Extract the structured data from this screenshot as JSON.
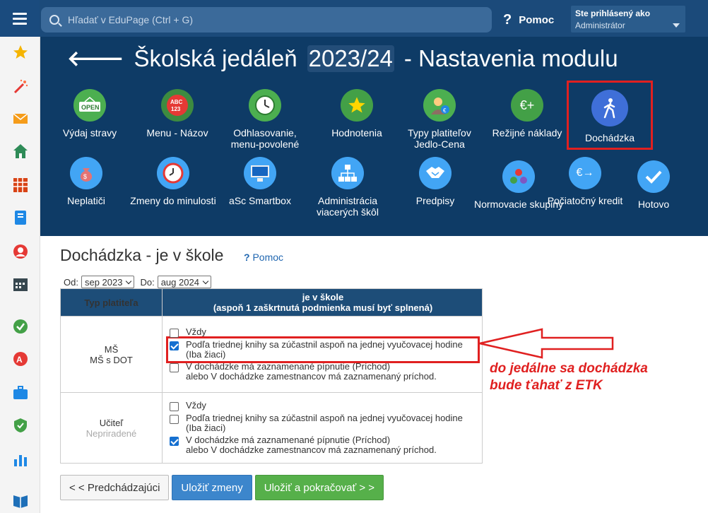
{
  "topbar": {
    "search_placeholder": "Hľadať v EduPage (Ctrl + G)",
    "help_label": "Pomoc",
    "login_title": "Ste prihlásený ako",
    "login_user": "Administrátor"
  },
  "header": {
    "title_prefix": "Školská jedáleň",
    "title_year": "2023/24",
    "title_suffix": "- Nastavenia modulu"
  },
  "tiles": [
    {
      "label": "Výdaj stravy",
      "icon": "open-sign-icon",
      "color": "#4caf50"
    },
    {
      "label": "Menu - Názov",
      "icon": "abc-icon",
      "color": "#3d8b40"
    },
    {
      "label": "Odhlasovanie, menu-povolené",
      "icon": "clock-icon",
      "color": "#4caf50"
    },
    {
      "label": "Hodnotenia",
      "icon": "star-icon",
      "color": "#43a047"
    },
    {
      "label": "Typy platiteľov Jedlo-Cena",
      "icon": "payer-icon",
      "color": "#4caf50"
    },
    {
      "label": "Režijné náklady",
      "icon": "euro-plus-icon",
      "color": "#43a047"
    },
    {
      "label": "Dochádzka",
      "icon": "walking-icon",
      "color": "#3f6fd8"
    },
    {
      "label": "Neplatiči",
      "icon": "moneybag-icon",
      "color": "#42a5f5"
    },
    {
      "label": "Zmeny do minulosti",
      "icon": "history-clock-icon",
      "color": "#42a5f5"
    },
    {
      "label": "aSc Smartbox",
      "icon": "monitor-icon",
      "color": "#42a5f5"
    },
    {
      "label": "Administrácia viacerých škôl",
      "icon": "hierarchy-icon",
      "color": "#42a5f5"
    },
    {
      "label": "Predpisy",
      "icon": "handshake-icon",
      "color": "#42a5f5"
    },
    {
      "label": "Normovacie skupiny",
      "icon": "dots-icon",
      "color": "#42a5f5"
    },
    {
      "label": "Počiatočný kredit",
      "icon": "euro-arrow-icon",
      "color": "#42a5f5"
    },
    {
      "label": "Hotovo",
      "icon": "check-icon",
      "color": "#42a5f5"
    }
  ],
  "page": {
    "heading": "Dochádzka - je v škole",
    "help_mark": "?",
    "help_label": "Pomoc",
    "from_label": "Od:",
    "from_value": "sep 2023",
    "to_label": "Do:",
    "to_value": "aug 2024"
  },
  "table": {
    "col1_header": "Typ platiteľa",
    "col2_header_line1": "je v škole",
    "col2_header_line2": "(aspoň 1 zaškrtnutá podmienka musí byť splnená)",
    "rows": [
      {
        "type_line1": "MŠ",
        "type_line2": "MŠ s DOT",
        "options": [
          {
            "line1": "Vždy",
            "line2": "",
            "checked": false
          },
          {
            "line1": "Podľa triednej knihy sa zúčastnil aspoň na jednej vyučovacej hodine",
            "line2": "(Iba žiaci)",
            "checked": true
          },
          {
            "line1": "V dochádzke má zaznamenané pípnutie (Príchod)",
            "line2": "alebo V dochádzke zamestnancov má zaznamenaný príchod.",
            "checked": false
          }
        ]
      },
      {
        "type_line1": "Učiteľ",
        "type_line2": "Nepriradené",
        "options": [
          {
            "line1": "Vždy",
            "line2": "",
            "checked": false
          },
          {
            "line1": "Podľa triednej knihy sa zúčastnil aspoň na jednej vyučovacej hodine",
            "line2": "(Iba žiaci)",
            "checked": false
          },
          {
            "line1": "V dochádzke má zaznamenané pípnutie (Príchod)",
            "line2": "alebo V dochádzke zamestnancov má zaznamenaný príchod.",
            "checked": true
          }
        ]
      }
    ]
  },
  "annotation": {
    "line1": "do jedálne sa dochádzka",
    "line2": "bude ťahať z ETK"
  },
  "buttons": {
    "prev": "< < Predchádzajúci",
    "save": "Uložiť zmeny",
    "save_next": "Uložiť a pokračovať > >"
  }
}
